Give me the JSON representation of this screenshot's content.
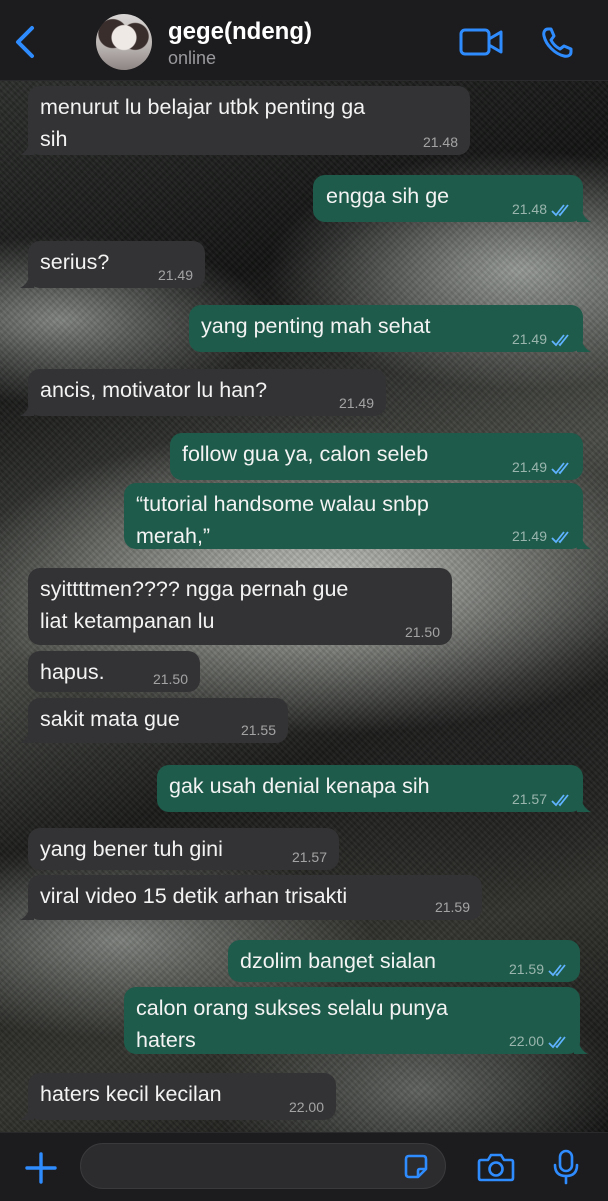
{
  "header": {
    "contact_name": "gege(ndeng)",
    "status": "online"
  },
  "messages": [
    {
      "dir": "in",
      "text": "menurut lu belajar utbk penting ga sih",
      "time": "21.48"
    },
    {
      "dir": "out",
      "text": "engga sih ge",
      "time": "21.48",
      "read": true
    },
    {
      "dir": "in",
      "text": "serius?",
      "time": "21.49"
    },
    {
      "dir": "out",
      "text": "yang penting mah sehat",
      "time": "21.49",
      "read": true
    },
    {
      "dir": "in",
      "text": "ancis, motivator lu han?",
      "time": "21.49"
    },
    {
      "dir": "out",
      "text": "follow gua ya, calon seleb",
      "time": "21.49",
      "read": true
    },
    {
      "dir": "out",
      "text": "“tutorial handsome walau snbp merah,”",
      "time": "21.49",
      "read": true
    },
    {
      "dir": "in",
      "text": "syittttmen???? ngga pernah gue liat ketampanan lu",
      "time": "21.50"
    },
    {
      "dir": "in",
      "text": "hapus.",
      "time": "21.50"
    },
    {
      "dir": "in",
      "text": "sakit mata gue",
      "time": "21.55"
    },
    {
      "dir": "out",
      "text": "gak usah denial kenapa sih",
      "time": "21.57",
      "read": true
    },
    {
      "dir": "in",
      "text": "yang bener tuh gini",
      "time": "21.57"
    },
    {
      "dir": "in",
      "text": "viral video 15 detik arhan trisakti",
      "time": "21.59"
    },
    {
      "dir": "out",
      "text": "dzolim banget sialan",
      "time": "21.59",
      "read": true
    },
    {
      "dir": "out",
      "text": "calon orang sukses selalu punya haters",
      "time": "22.00",
      "read": true
    },
    {
      "dir": "in",
      "text": "haters kecil kecilan",
      "time": "22.00"
    }
  ],
  "input": {
    "placeholder": "",
    "value": ""
  },
  "icons": {
    "back": "chevron-left-icon",
    "video": "video-camera-icon",
    "call": "phone-icon",
    "plus": "plus-icon",
    "sticker": "sticker-icon",
    "camera": "camera-icon",
    "mic": "microphone-icon"
  },
  "colors": {
    "accent": "#2f8cff",
    "bubble_in": "#333335",
    "bubble_out": "#1e5b4a",
    "read_ticks": "#5fb2ff"
  }
}
